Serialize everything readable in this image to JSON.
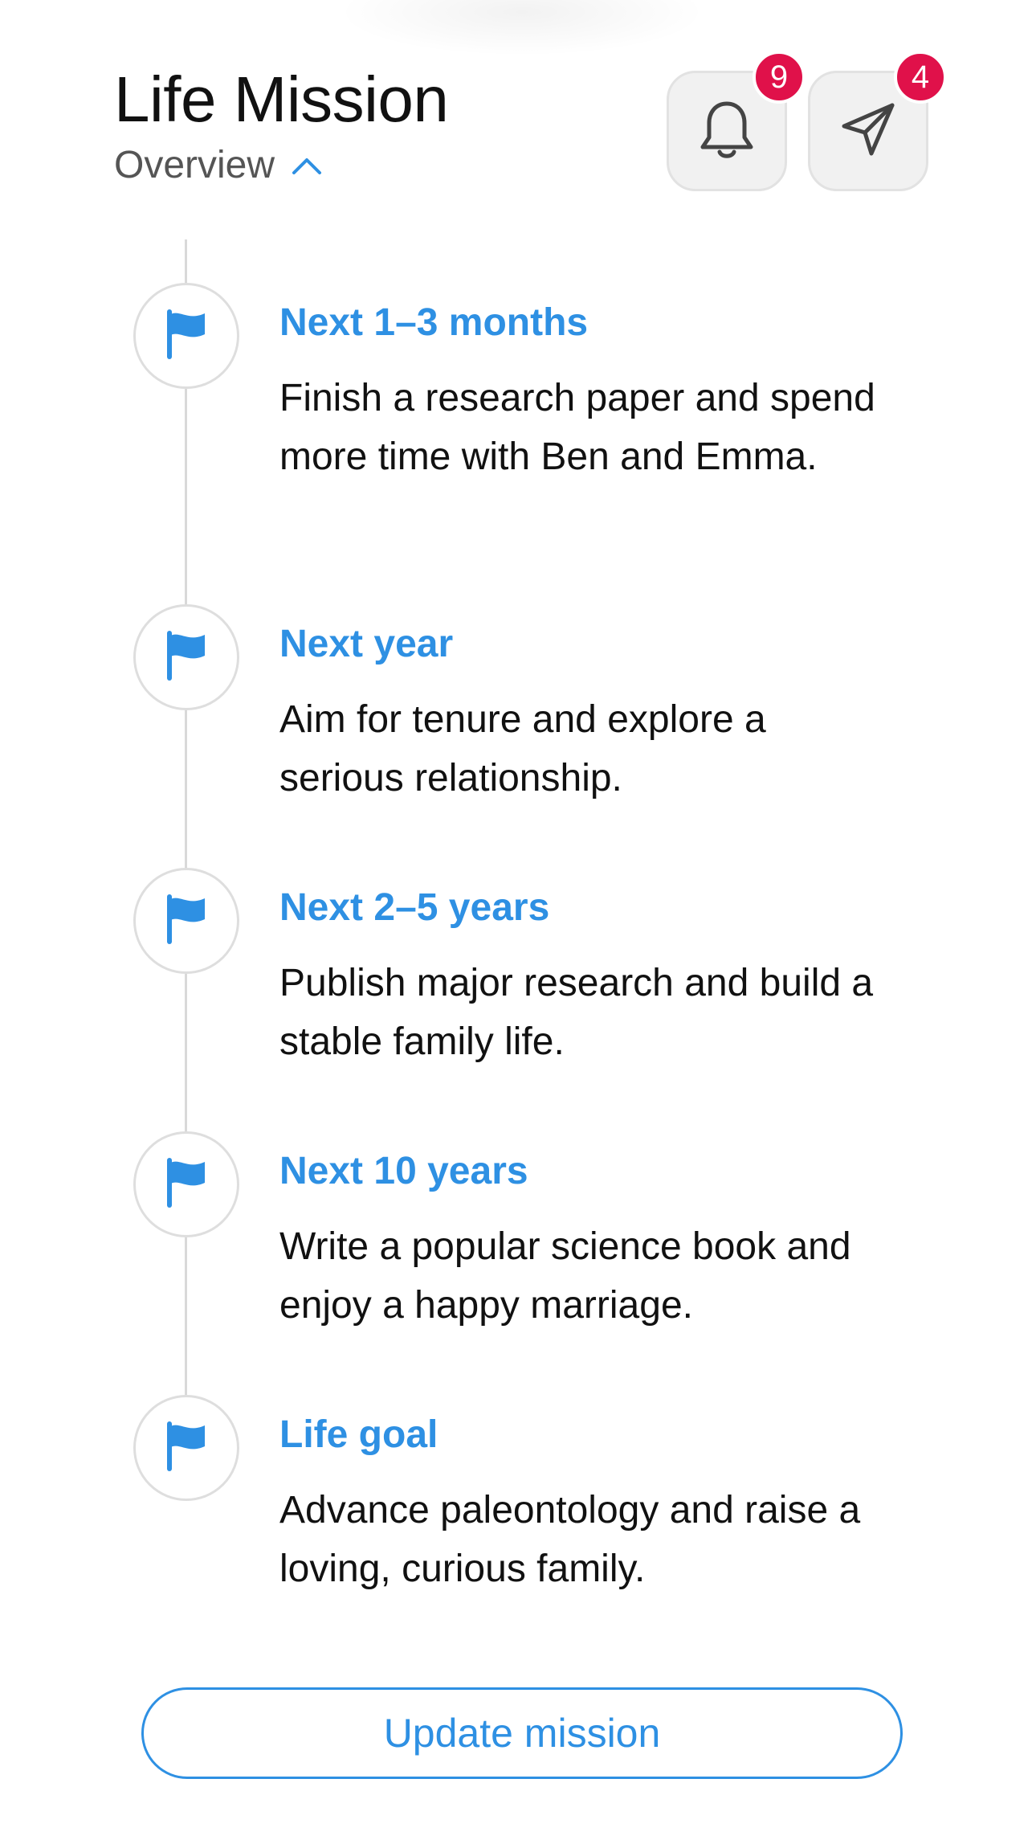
{
  "header": {
    "title": "Life Mission",
    "subtitle": "Overview"
  },
  "notifications": {
    "count": "9",
    "icon": "bell-icon"
  },
  "messages": {
    "count": "4",
    "icon": "send-icon"
  },
  "timeline": [
    {
      "heading": "Next 1–3 months",
      "description": "Finish a research paper and spend more time with Ben and Emma."
    },
    {
      "heading": "Next year",
      "description": "Aim for tenure and explore a serious relationship."
    },
    {
      "heading": "Next 2–5 years",
      "description": "Publish major research and build a stable family life."
    },
    {
      "heading": "Next 10 years",
      "description": "Write a popular science book and enjoy a happy marriage."
    },
    {
      "heading": "Life goal",
      "description": "Advance paleontology and raise a loving, curious family."
    }
  ],
  "update_button": {
    "label": "Update mission"
  },
  "colors": {
    "accent": "#2e90e3",
    "badge": "#e0114a",
    "text": "#111111",
    "muted": "#555555"
  }
}
